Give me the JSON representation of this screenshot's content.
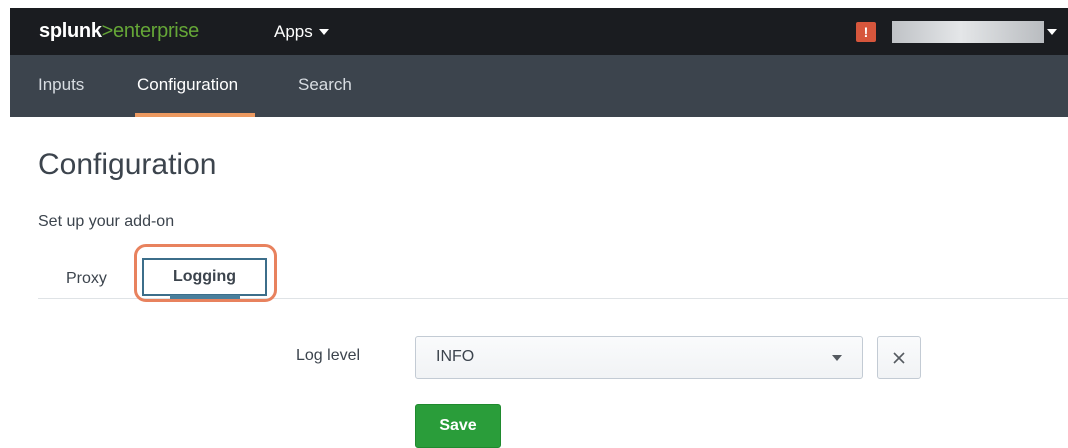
{
  "header": {
    "logo_brand": "splunk",
    "logo_suffix": ">enterprise",
    "apps_label": "Apps",
    "alert_icon": "!",
    "user_name": ""
  },
  "nav": {
    "items": [
      {
        "label": "Inputs",
        "active": false
      },
      {
        "label": "Configuration",
        "active": true
      },
      {
        "label": "Search",
        "active": false
      }
    ]
  },
  "page": {
    "title": "Configuration",
    "subtitle": "Set up your add-on"
  },
  "tabs": [
    {
      "label": "Proxy",
      "active": false
    },
    {
      "label": "Logging",
      "active": true
    }
  ],
  "form": {
    "log_level_label": "Log level",
    "log_level_value": "INFO",
    "save_label": "Save"
  },
  "colors": {
    "topbar": "#1a1c20",
    "appnav": "#3c444d",
    "nav_active_underline": "#ec9960",
    "logo_accent": "#65a637",
    "alert": "#d6563c",
    "save_button": "#2a9d3a",
    "highlight": "#e8825e"
  },
  "icons": {
    "apps_caret": "chevron-down-icon",
    "alert": "alert-icon",
    "select_caret": "chevron-down-icon",
    "clear": "close-icon"
  }
}
